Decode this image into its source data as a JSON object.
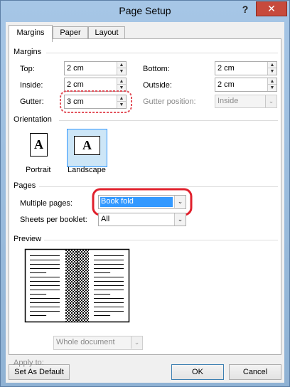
{
  "window": {
    "title": "Page Setup",
    "help_label": "?",
    "close_label": "✕"
  },
  "tabs": [
    {
      "label": "Margins",
      "active": true
    },
    {
      "label": "Paper",
      "active": false
    },
    {
      "label": "Layout",
      "active": false
    }
  ],
  "margins": {
    "section_title": "Margins",
    "top": {
      "label": "Top:",
      "value": "2 cm"
    },
    "bottom": {
      "label": "Bottom:",
      "value": "2 cm"
    },
    "inside": {
      "label": "Inside:",
      "value": "2 cm"
    },
    "outside": {
      "label": "Outside:",
      "value": "2 cm"
    },
    "gutter": {
      "label": "Gutter:",
      "value": "3 cm"
    },
    "gutter_position": {
      "label": "Gutter position:",
      "value": "Inside",
      "disabled": true
    }
  },
  "orientation": {
    "section_title": "Orientation",
    "portrait": {
      "label": "Portrait",
      "glyph": "A",
      "selected": false
    },
    "landscape": {
      "label": "Landscape",
      "glyph": "A",
      "selected": true
    }
  },
  "pages": {
    "section_title": "Pages",
    "multiple_pages": {
      "label": "Multiple pages:",
      "value": "Book fold"
    },
    "sheets_per_booklet": {
      "label": "Sheets per booklet:",
      "value": "All"
    }
  },
  "preview": {
    "section_title": "Preview"
  },
  "apply_to": {
    "label": "Apply to:",
    "value": "Whole document",
    "disabled": true
  },
  "buttons": {
    "set_as_default": "Set As Default",
    "ok": "OK",
    "cancel": "Cancel"
  },
  "colors": {
    "highlight_ring": "#e0202c",
    "gutter_ring": "#e2505a",
    "selection_blue": "#3399ff",
    "selection_bg": "#cde6f7"
  }
}
